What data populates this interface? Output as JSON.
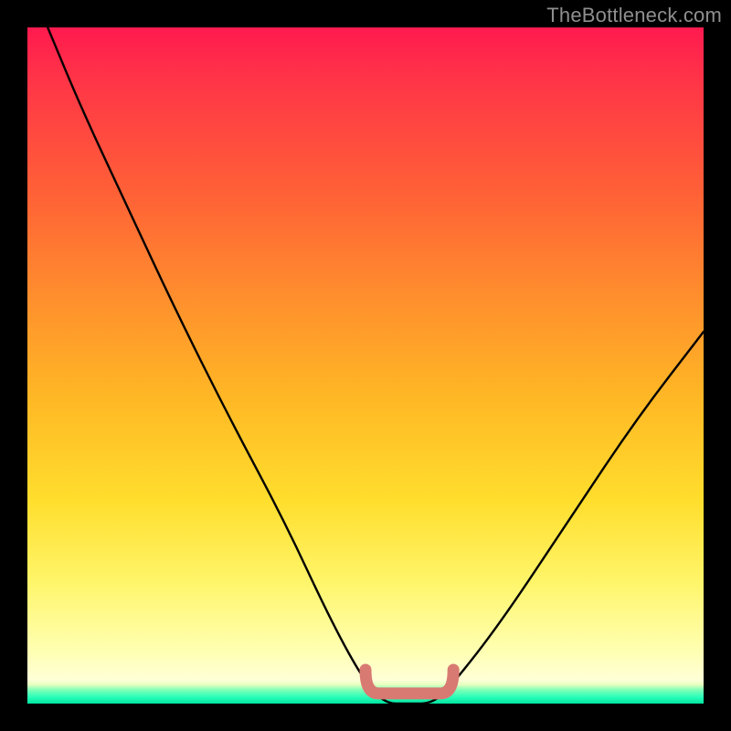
{
  "watermark": "TheBottleneck.com",
  "chart_data": {
    "type": "line",
    "title": "",
    "xlabel": "",
    "ylabel": "",
    "xlim": [
      0,
      100
    ],
    "ylim": [
      0,
      100
    ],
    "grid": false,
    "legend": false,
    "series": [
      {
        "name": "bottleneck-curve",
        "x": [
          3,
          8,
          15,
          22,
          30,
          38,
          45,
          50,
          53,
          56,
          60,
          63,
          70,
          80,
          90,
          100
        ],
        "y": [
          100,
          88,
          73,
          58,
          42,
          27,
          12,
          3,
          0,
          0,
          0,
          3,
          12,
          27,
          42,
          55
        ]
      }
    ],
    "annotations": [
      {
        "name": "flat-bottom-highlight",
        "x_range": [
          50,
          63
        ],
        "y": 1.5,
        "color": "#d87a72"
      }
    ],
    "colors": {
      "curve": "#000000",
      "highlight": "#d87a72",
      "gradient_top": "#ff1a4f",
      "gradient_mid": "#ffde2d",
      "gradient_bottom": "#00e5a0",
      "frame": "#000000"
    }
  }
}
